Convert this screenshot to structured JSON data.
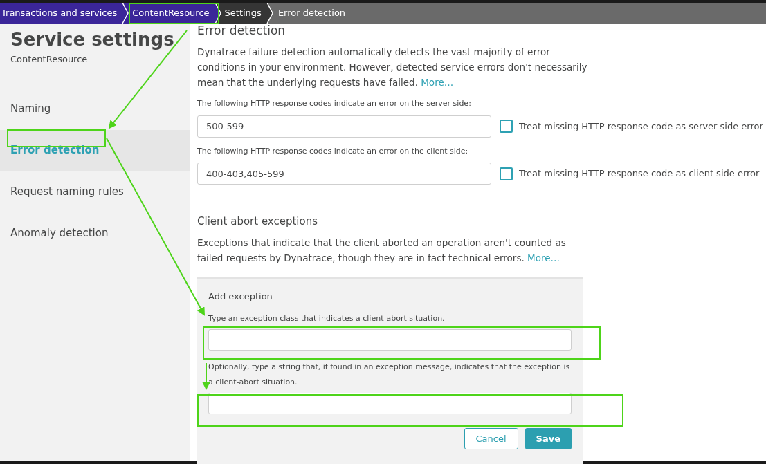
{
  "breadcrumb": [
    {
      "label": "Transactions and services",
      "color": "#3b2699"
    },
    {
      "label": "ContentResource",
      "color": "#3b2699"
    },
    {
      "label": "Settings",
      "color": "#353535"
    },
    {
      "label": "Error detection",
      "color": "#6a6a6a"
    }
  ],
  "sidebar": {
    "title": "Service settings",
    "subtitle": "ContentResource",
    "items": [
      {
        "label": "Naming",
        "selected": false
      },
      {
        "label": "Error detection",
        "selected": true
      },
      {
        "label": "Request naming rules",
        "selected": false
      },
      {
        "label": "Anomaly detection",
        "selected": false
      }
    ]
  },
  "error_detection": {
    "heading": "Error detection",
    "description": "Dynatrace failure detection automatically detects the vast majority of error conditions in your environment. However, detected service errors don't necessarily mean that the underlying requests have failed.",
    "more_link": "More…",
    "fields": [
      {
        "label": "The following HTTP response codes indicate an error on the server side:",
        "value": "500-599",
        "checkbox": {
          "label": "Treat missing HTTP response code as server side error",
          "checked": false
        }
      },
      {
        "label": "The following HTTP response codes indicate an error on the client side:",
        "value": "400-403,405-599",
        "checkbox": {
          "label": "Treat missing HTTP response code as client side error",
          "checked": false
        }
      }
    ]
  },
  "client_abort": {
    "heading": "Client abort exceptions",
    "description": "Exceptions that indicate that the client aborted an operation aren't counted as failed requests by Dynatrace, though they are in fact technical errors.",
    "more_link": "More…",
    "panel": {
      "heading": "Add exception",
      "fields": [
        {
          "label": "Type an exception class that indicates a client-abort situation."
        },
        {
          "label": "Optionally, type a string that, if found in an exception message, indicates that the exception is a client-abort situation."
        }
      ],
      "buttons": [
        {
          "label": "Cancel",
          "kind": "secondary"
        },
        {
          "label": "Save",
          "kind": "primary"
        }
      ]
    }
  }
}
